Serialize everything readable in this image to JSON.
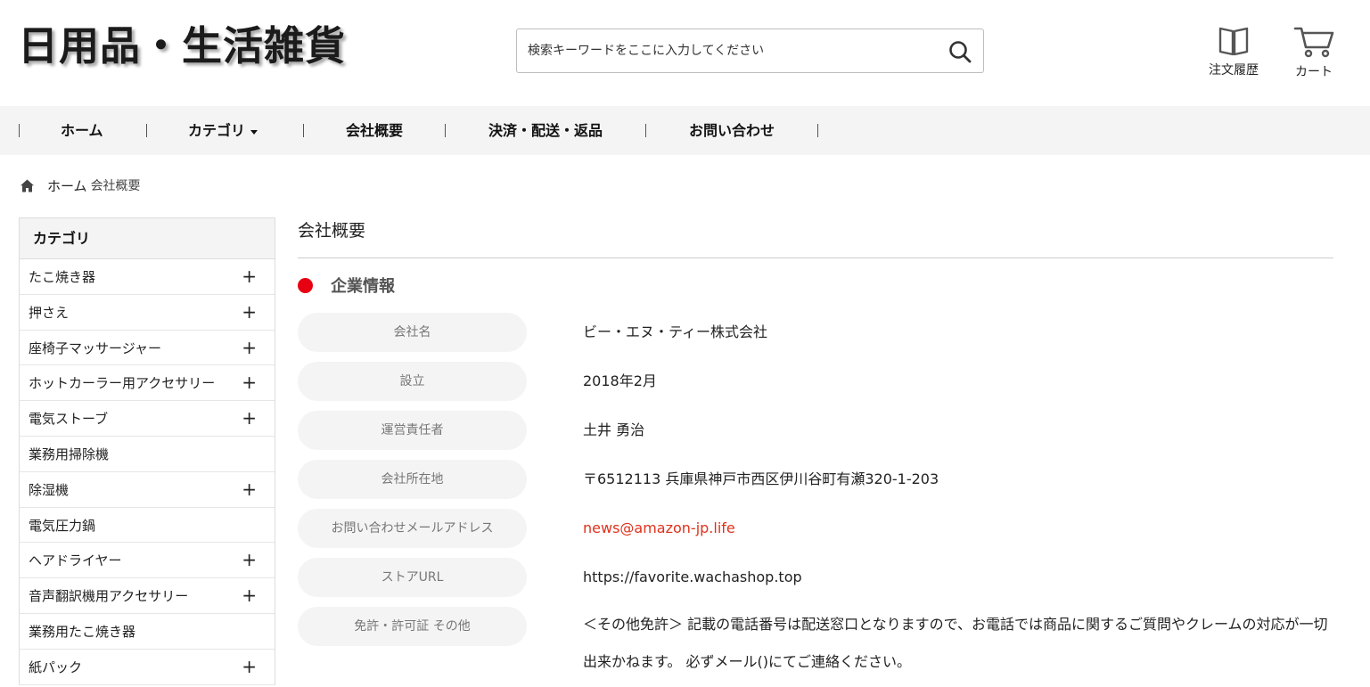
{
  "header": {
    "logo": "日用品・生活雑貨",
    "search_placeholder": "検索キーワードをここに入力してください",
    "history_label": "注文履歴",
    "cart_label": "カート"
  },
  "nav": {
    "items": [
      "ホーム",
      "カテゴリ",
      "会社概要",
      "決済・配送・返品",
      "お問い合わせ"
    ]
  },
  "breadcrumb": {
    "home": "ホーム",
    "current": "会社概要"
  },
  "sidebar": {
    "title": "カテゴリ",
    "items": [
      {
        "label": "たこ焼き器",
        "expand": "+"
      },
      {
        "label": "押さえ",
        "expand": "+"
      },
      {
        "label": "座椅子マッサージャー",
        "expand": "+"
      },
      {
        "label": "ホットカーラー用アクセサリー",
        "expand": "+"
      },
      {
        "label": "電気ストーブ",
        "expand": "+"
      },
      {
        "label": "業務用掃除機",
        "expand": ""
      },
      {
        "label": "除湿機",
        "expand": "+"
      },
      {
        "label": "電気圧力鍋",
        "expand": ""
      },
      {
        "label": "ヘアドライヤー",
        "expand": "+"
      },
      {
        "label": "音声翻訳機用アクセサリー",
        "expand": "+"
      },
      {
        "label": "業務用たこ焼き器",
        "expand": ""
      },
      {
        "label": "紙パック",
        "expand": "+"
      }
    ]
  },
  "main": {
    "title": "会社概要",
    "section_title": "企業情報",
    "rows": [
      {
        "label": "会社名",
        "value": "ビー・エヌ・ティー株式会社"
      },
      {
        "label": "設立",
        "value": "2018年2月"
      },
      {
        "label": "運営責任者",
        "value": "土井 勇治"
      },
      {
        "label": "会社所在地",
        "value": "〒6512113 兵庫県神戸市西区伊川谷町有瀬320-1-203"
      },
      {
        "label": "お問い合わせメールアドレス",
        "value": "news@amazon-jp.life"
      },
      {
        "label": "ストアURL",
        "value": "https://favorite.wachashop.top"
      },
      {
        "label": "免許・許可証 その他",
        "value": "＜その他免許＞ 記載の電話番号は配送窓口となりますので、お電話では商品に関するご質問やクレームの対応が一切出来かねます。 必ずメール()にてご連絡ください。"
      }
    ]
  },
  "colors": {
    "accent_red": "#e60012",
    "email_link": "#e0311c",
    "nav_bg": "#f4f4f4"
  }
}
